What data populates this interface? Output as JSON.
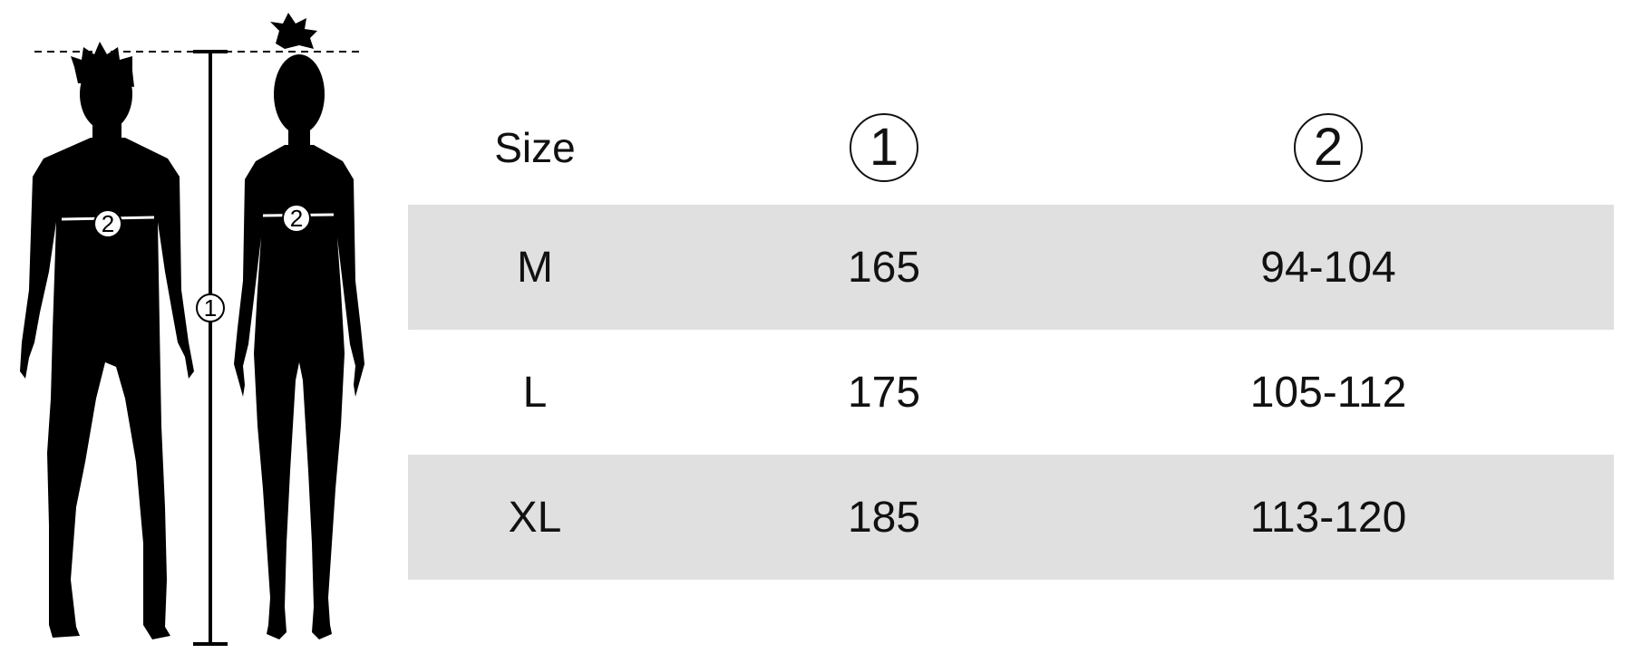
{
  "figure": {
    "height_marker": "1",
    "chest_marker_male": "2",
    "chest_marker_female": "2"
  },
  "table": {
    "headers": [
      "Size",
      "1",
      "2"
    ],
    "rows": [
      {
        "size": "M",
        "height": "165",
        "chest": "94-104"
      },
      {
        "size": "L",
        "height": "175",
        "chest": "105-112"
      },
      {
        "size": "XL",
        "height": "185",
        "chest": "113-120"
      }
    ]
  },
  "colors": {
    "silhouette": "#000000",
    "row_shade": "#e0e0e0",
    "background": "#ffffff"
  }
}
